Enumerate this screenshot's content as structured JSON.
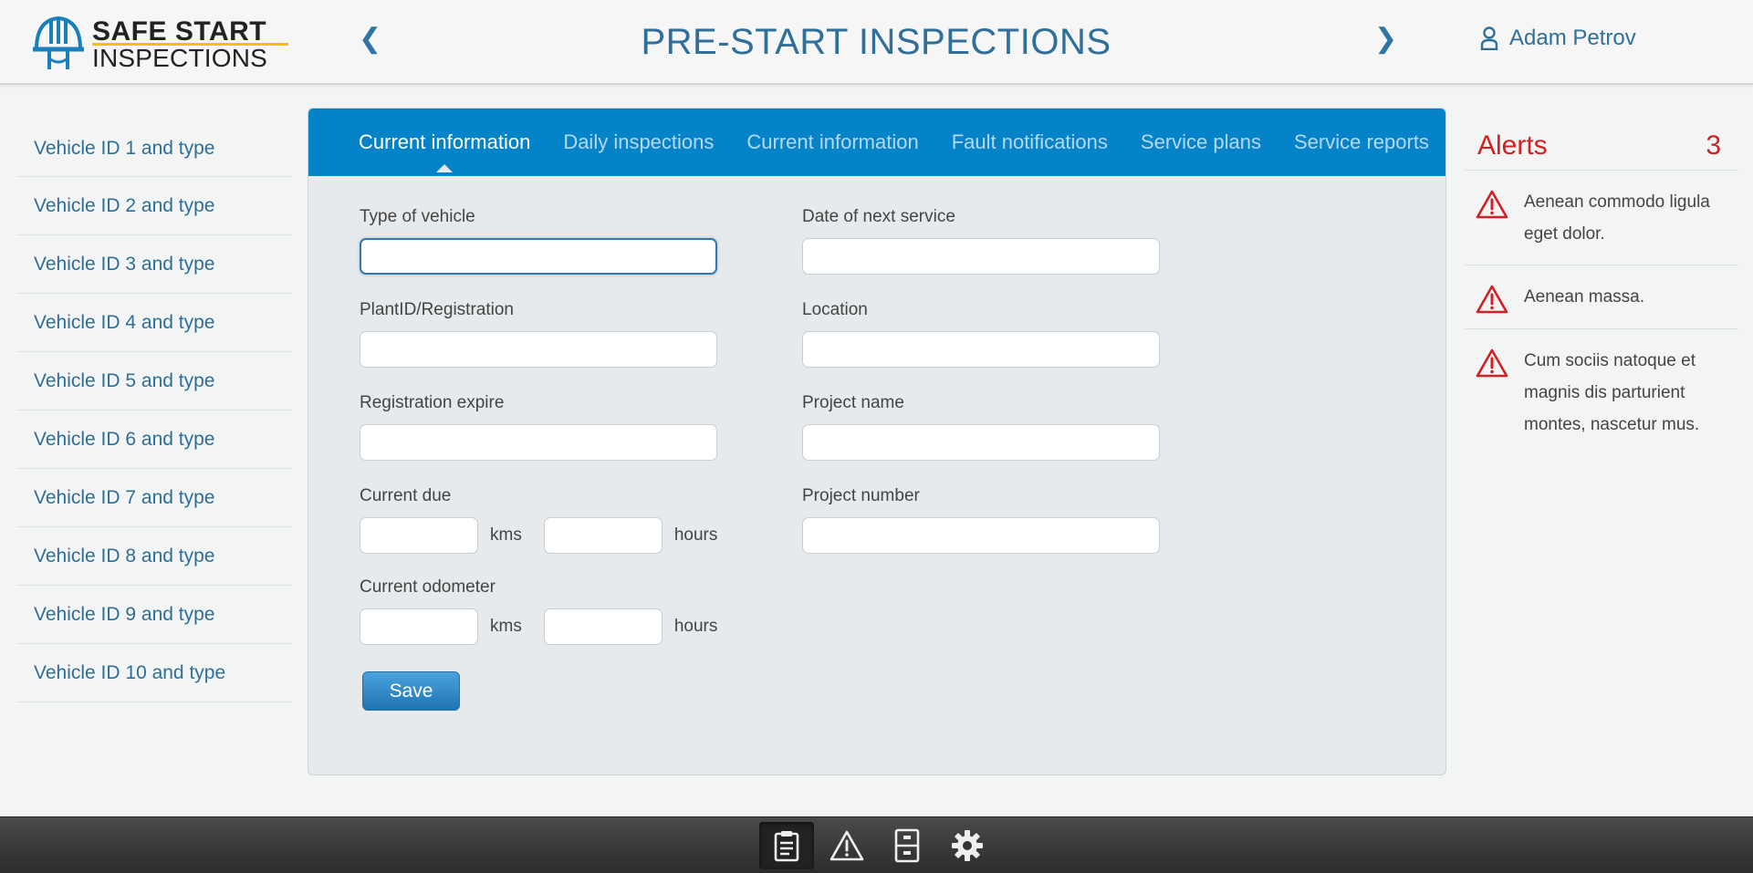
{
  "header": {
    "logo_line1": "SAFE START",
    "logo_line2": "INSPECTIONS",
    "title": "PRE-START INSPECTIONS",
    "prev_arrow": "❮",
    "next_arrow": "❯",
    "user_name": "Adam Petrov",
    "user_icon": "user-icon"
  },
  "sidebar": {
    "items": [
      {
        "label": "Vehicle ID 1 and type"
      },
      {
        "label": "Vehicle ID 2 and type"
      },
      {
        "label": "Vehicle ID 3 and type"
      },
      {
        "label": "Vehicle ID 4 and type"
      },
      {
        "label": "Vehicle ID 5 and type"
      },
      {
        "label": "Vehicle ID 6 and type"
      },
      {
        "label": "Vehicle ID 7 and type"
      },
      {
        "label": "Vehicle ID 8 and type"
      },
      {
        "label": "Vehicle ID 9 and type"
      },
      {
        "label": "Vehicle ID 10 and type"
      }
    ]
  },
  "tabs": [
    {
      "label": "Current information",
      "active": true
    },
    {
      "label": "Daily inspections"
    },
    {
      "label": "Current information"
    },
    {
      "label": "Fault notifications"
    },
    {
      "label": "Service plans"
    },
    {
      "label": "Service reports"
    }
  ],
  "form": {
    "left": {
      "type_of_vehicle": {
        "label": "Type of vehicle",
        "value": ""
      },
      "plant_id": {
        "label": "PlantID/Registration",
        "value": ""
      },
      "registration_expire": {
        "label": "Registration expire",
        "value": ""
      },
      "current_due": {
        "label": "Current due",
        "unit1": "kms",
        "unit2": "hours"
      },
      "current_odometer": {
        "label": "Current odometer",
        "unit1": "kms",
        "unit2": "hours"
      }
    },
    "right": {
      "next_service": {
        "label": "Date of next service",
        "value": ""
      },
      "location": {
        "label": "Location",
        "value": ""
      },
      "project_name": {
        "label": "Project name",
        "value": ""
      },
      "project_number": {
        "label": "Project number",
        "value": ""
      }
    },
    "save_label": "Save"
  },
  "alerts": {
    "title": "Alerts",
    "count": "3",
    "items": [
      {
        "text": "Aenean commodo ligula eget dolor."
      },
      {
        "text": "Aenean massa."
      },
      {
        "text": "Cum sociis natoque et magnis dis parturient montes, nascetur mus."
      }
    ]
  },
  "bottom_bar": {
    "icons": [
      "clipboard-icon",
      "warning-icon",
      "cabinet-icon",
      "gear-icon"
    ],
    "active": "clipboard-icon"
  },
  "colors": {
    "accent": "#0583c8",
    "title": "#2f6f99",
    "alert": "#d32022"
  }
}
